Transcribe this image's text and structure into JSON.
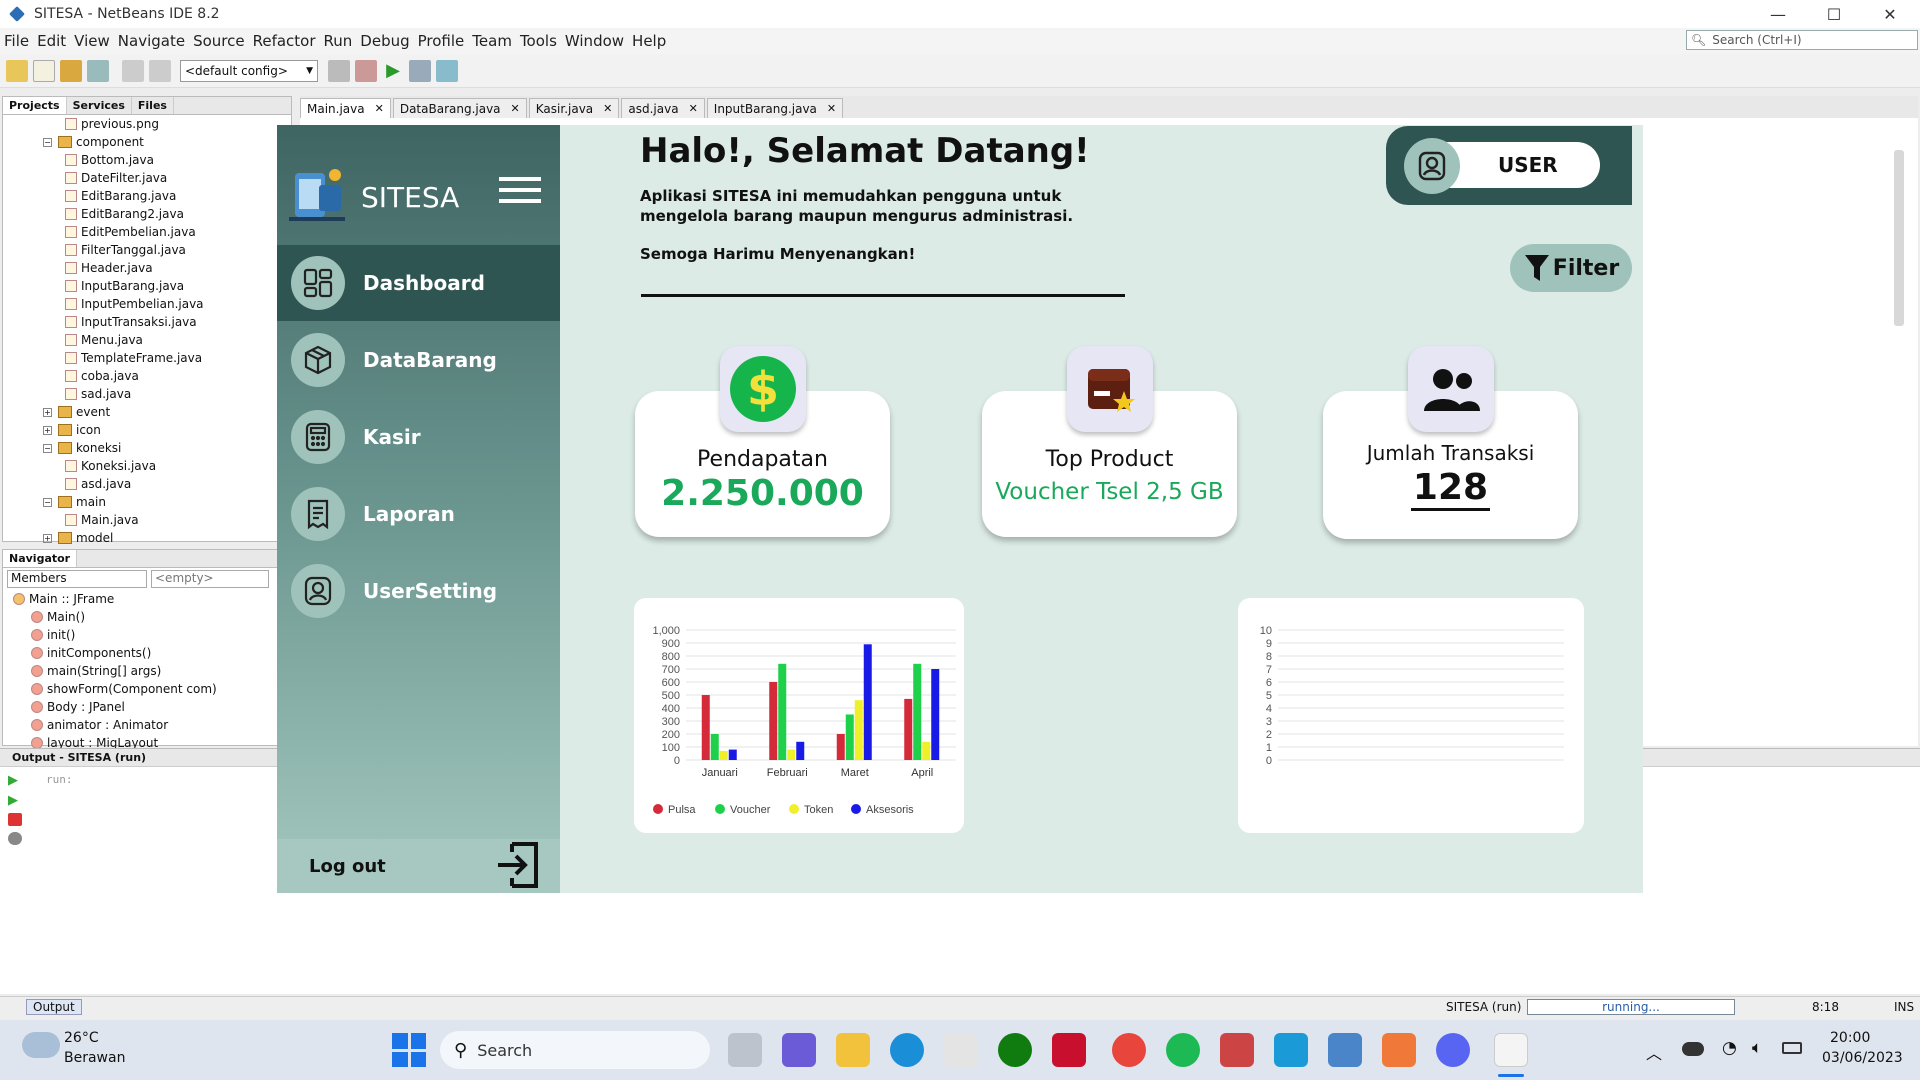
{
  "window": {
    "title": "SITESA - NetBeans IDE 8.2"
  },
  "menu": [
    "File",
    "Edit",
    "View",
    "Navigate",
    "Source",
    "Refactor",
    "Run",
    "Debug",
    "Profile",
    "Team",
    "Tools",
    "Window",
    "Help"
  ],
  "ide_search": {
    "placeholder": "Search (Ctrl+I)"
  },
  "toolbar": {
    "config": "<default config>"
  },
  "projects": {
    "tabs": [
      "Projects",
      "Services",
      "Files"
    ],
    "tree": [
      {
        "label": "previous.png",
        "kind": "file",
        "depth": 2
      },
      {
        "label": "component",
        "kind": "package",
        "depth": 1,
        "exp": "−"
      },
      {
        "label": "Bottom.java",
        "kind": "file",
        "depth": 2
      },
      {
        "label": "DateFilter.java",
        "kind": "file",
        "depth": 2
      },
      {
        "label": "EditBarang.java",
        "kind": "file",
        "depth": 2
      },
      {
        "label": "EditBarang2.java",
        "kind": "file",
        "depth": 2
      },
      {
        "label": "EditPembelian.java",
        "kind": "file",
        "depth": 2
      },
      {
        "label": "FilterTanggal.java",
        "kind": "file",
        "depth": 2
      },
      {
        "label": "Header.java",
        "kind": "file",
        "depth": 2
      },
      {
        "label": "InputBarang.java",
        "kind": "file",
        "depth": 2
      },
      {
        "label": "InputPembelian.java",
        "kind": "file",
        "depth": 2
      },
      {
        "label": "InputTransaksi.java",
        "kind": "file",
        "depth": 2
      },
      {
        "label": "Menu.java",
        "kind": "file",
        "depth": 2
      },
      {
        "label": "TemplateFrame.java",
        "kind": "file",
        "depth": 2
      },
      {
        "label": "coba.java",
        "kind": "file",
        "depth": 2
      },
      {
        "label": "sad.java",
        "kind": "file",
        "depth": 2
      },
      {
        "label": "event",
        "kind": "package",
        "depth": 1,
        "exp": "+"
      },
      {
        "label": "icon",
        "kind": "package",
        "depth": 1,
        "exp": "+"
      },
      {
        "label": "koneksi",
        "kind": "package",
        "depth": 1,
        "exp": "−"
      },
      {
        "label": "Koneksi.java",
        "kind": "file",
        "depth": 2
      },
      {
        "label": "asd.java",
        "kind": "file",
        "depth": 2
      },
      {
        "label": "main",
        "kind": "package",
        "depth": 1,
        "exp": "−"
      },
      {
        "label": "Main.java",
        "kind": "file",
        "depth": 2
      },
      {
        "label": "model",
        "kind": "package",
        "depth": 1,
        "exp": "+"
      }
    ]
  },
  "navigator": {
    "title": "Navigator",
    "filter": "Members",
    "scope": "<empty>",
    "items": [
      {
        "label": "Main :: JFrame",
        "depth": 0
      },
      {
        "label": "Main()",
        "depth": 1
      },
      {
        "label": "init()",
        "depth": 1
      },
      {
        "label": "initComponents()",
        "depth": 1
      },
      {
        "label": "main(String[] args)",
        "depth": 1
      },
      {
        "label": "showForm(Component com)",
        "depth": 1
      },
      {
        "label": "Body : JPanel",
        "depth": 1
      },
      {
        "label": "animator : Animator",
        "depth": 1
      },
      {
        "label": "layout : MigLayout",
        "depth": 1
      }
    ]
  },
  "editor_tabs": [
    "Main.java",
    "DataBarang.java",
    "Kasir.java",
    "asd.java",
    "InputBarang.java"
  ],
  "app": {
    "logo_text": "SITESA",
    "nav": [
      "Dashboard",
      "DataBarang",
      "Kasir",
      "Laporan",
      "UserSetting"
    ],
    "logout": "Log out",
    "greeting": "Halo!, Selamat Datang!",
    "description_line1": "Aplikasi SITESA ini memudahkan pengguna untuk",
    "description_line2": "mengelola barang maupun mengurus administrasi.",
    "wish": "Semoga Harimu Menyenangkan!",
    "user_label": "USER",
    "filter_label": "Filter",
    "cards": [
      {
        "title": "Pendapatan",
        "value": "2.250.000",
        "color": "#1aa85a"
      },
      {
        "title": "Top Product",
        "value": "Voucher Tsel 2,5 GB",
        "color": "#1aa85a"
      },
      {
        "title": "Jumlah Transaksi",
        "value": "128",
        "color": "#111111"
      }
    ]
  },
  "chart_data": [
    {
      "type": "bar",
      "categories": [
        "Januari",
        "Februari",
        "Maret",
        "April"
      ],
      "ylim": [
        0,
        1000
      ],
      "yticks": [
        "0",
        "100",
        "200",
        "300",
        "400",
        "500",
        "600",
        "700",
        "800",
        "900",
        "1,000"
      ],
      "series": [
        {
          "name": "Pulsa",
          "color": "#d42a3a",
          "values": [
            500,
            600,
            200,
            470
          ]
        },
        {
          "name": "Voucher",
          "color": "#1fd14a",
          "values": [
            200,
            740,
            350,
            740
          ]
        },
        {
          "name": "Token",
          "color": "#f0f02a",
          "values": [
            70,
            80,
            460,
            140
          ]
        },
        {
          "name": "Aksesoris",
          "color": "#1a1ae6",
          "values": [
            80,
            140,
            890,
            700
          ]
        }
      ]
    },
    {
      "type": "bar",
      "categories": [],
      "ylim": [
        0,
        10
      ],
      "yticks": [
        "0",
        "1",
        "2",
        "3",
        "4",
        "5",
        "6",
        "7",
        "8",
        "9",
        "10"
      ],
      "series": []
    }
  ],
  "output": {
    "title": "Output - SITESA (run)",
    "text": "run:",
    "tab": "Output"
  },
  "status": {
    "project": "SITESA (run)",
    "progress": "running...",
    "position": "8:18",
    "mode": "INS"
  },
  "taskbar": {
    "weather_temp": "26°C",
    "weather_desc": "Berawan",
    "search": "Search",
    "time": "20:00",
    "date": "03/06/2023"
  }
}
